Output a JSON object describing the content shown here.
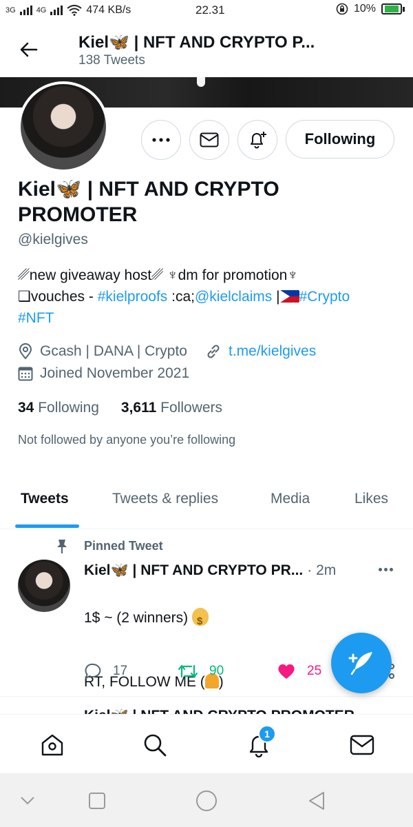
{
  "status_bar": {
    "signal_1": "3G",
    "signal_2": "4G",
    "speed": "474 KB/s",
    "time": "22.31",
    "battery": "10%"
  },
  "header": {
    "title": "Kiel🦋 | NFT AND CRYPTO P...",
    "subtitle": "138 Tweets"
  },
  "profile": {
    "display_name": "Kiel🦋 | NFT AND CRYPTO PROMOTER",
    "handle": "@kielgives",
    "bio_line1": "␥new giveaway host␥ ♆dm for promotion♆",
    "bio_vouches": "❑vouches - ",
    "bio_link1": "#kielproofs",
    "bio_mid": " :ca;",
    "bio_link2": "@kielclaims",
    "bio_sep": " |",
    "bio_link3": "#Crypto",
    "bio_link4": "#NFT",
    "location": "Gcash | DANA | Crypto",
    "website": "t.me/kielgives",
    "joined": "Joined November 2021",
    "following_count": "34",
    "following_label": "Following",
    "followers_count": "3,611",
    "followers_label": "Followers",
    "not_followed": "Not followed by anyone you’re following",
    "following_button": "Following"
  },
  "tabs": [
    {
      "label": "Tweets"
    },
    {
      "label": "Tweets & replies"
    },
    {
      "label": "Media"
    },
    {
      "label": "Likes"
    }
  ],
  "tweet": {
    "pinned_label": "Pinned Tweet",
    "author": "Kiel🦋 | NFT AND CRYPTO PR...",
    "meta": "· 2m",
    "text_line1": "1$ ~ (2 winners) ",
    "text_line2": "RT, FOLLOW ME (",
    "text_line2_end": ")",
    "replies": "17",
    "retweets": "90",
    "likes": "25"
  },
  "next_tweet": {
    "author": "Kiel🦋 | NFT AND CRYPTO PROMOTER"
  },
  "bottom_nav": {
    "notification_badge": "1"
  },
  "colors": {
    "accent": "#1d9bf0",
    "retweet": "#00ba7c",
    "like": "#f91880",
    "secondary_text": "#536471"
  }
}
